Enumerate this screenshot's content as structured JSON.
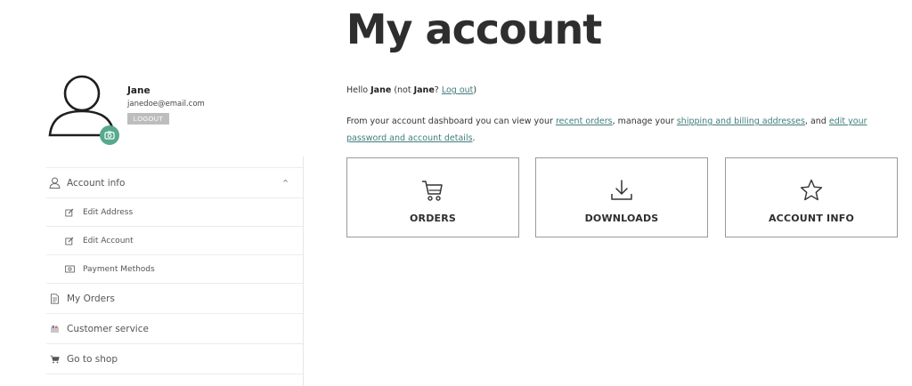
{
  "page": {
    "title": "My account"
  },
  "profile": {
    "name": "Jane",
    "email": "janedoe@email.com",
    "logout_label": "LOGOUT"
  },
  "sidebar": {
    "items": [
      {
        "label": "Account info",
        "icon": "user-icon",
        "expanded": true
      },
      {
        "label": "Edit Address",
        "icon": "edit-icon"
      },
      {
        "label": "Edit Account",
        "icon": "edit-icon"
      },
      {
        "label": "Payment Methods",
        "icon": "money-icon"
      },
      {
        "label": "My Orders",
        "icon": "document-icon"
      },
      {
        "label": "Customer service",
        "icon": "support-icon"
      },
      {
        "label": "Go to shop",
        "icon": "cart-icon"
      }
    ]
  },
  "greeting": {
    "hello": "Hello",
    "name": "Jane",
    "not_prefix": "(not",
    "not_name": "Jane",
    "question": "?",
    "logout_link": "Log out",
    "close": ")"
  },
  "intro": {
    "part1": "From your account dashboard you can view your",
    "link_orders": "recent orders",
    "part2": ", manage your",
    "link_addresses": "shipping and billing addresses",
    "part3": ", and",
    "link_account": "edit your password and account details",
    "part4": "."
  },
  "cards": [
    {
      "label": "ORDERS",
      "icon": "cart-icon"
    },
    {
      "label": "DOWNLOADS",
      "icon": "download-icon"
    },
    {
      "label": "ACCOUNT INFO",
      "icon": "star-icon"
    }
  ],
  "colors": {
    "accent": "#57a98d",
    "link": "#3f7d7b",
    "border": "#9a9a9a"
  }
}
